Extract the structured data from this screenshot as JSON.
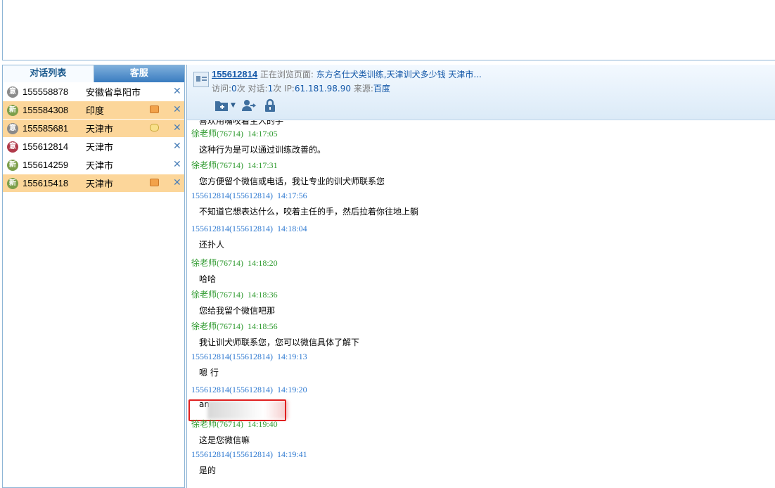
{
  "left_tabs": {
    "active": "对话列表",
    "inactive": "客服"
  },
  "conversations": [
    {
      "badge": "意",
      "id": "155558878",
      "location": "安徽省阜阳市"
    },
    {
      "badge": "新",
      "id": "155584308",
      "location": "印度"
    },
    {
      "badge": "意",
      "id": "155585681",
      "location": "天津市"
    },
    {
      "badge": "意",
      "id": "155612814",
      "location": "天津市"
    },
    {
      "badge": "新",
      "id": "155614259",
      "location": "天津市"
    },
    {
      "badge": "新",
      "id": "155615418",
      "location": "天津市"
    }
  ],
  "close_glyph": "✕",
  "header": {
    "visitor_id": "155612814",
    "browsing_label": "正在浏览页面:",
    "browsing_page": "东方名仕犬类训练,天津训犬多少钱 天津市...",
    "visits_label": "访问:",
    "visits_value": "0",
    "times_unit": "次",
    "dialog_label": " 对话:",
    "dialog_value": "1",
    "ip_label": " IP:",
    "ip_value": "61.181.98.90",
    "source_label": " 来源:",
    "source_value": "百度"
  },
  "chat": {
    "partial_text": "喜欢用嘴咬着主人的手",
    "messages": [
      {
        "sender": "徐老师(76714)",
        "time": "14:17:05",
        "text": "这种行为是可以通过训练改善的。",
        "role": "agent"
      },
      {
        "sender": "徐老师(76714)",
        "time": "14:17:31",
        "text": "您方便留个微信或电话，我让专业的训犬师联系您",
        "role": "agent"
      },
      {
        "sender": "155612814(155612814)",
        "time": "14:17:56",
        "text": "不知道它想表达什么，咬着主任的手，然后拉着你往地上躺",
        "role": "visitor"
      },
      {
        "sender": "155612814(155612814)",
        "time": "14:18:04",
        "text": "还扑人",
        "role": "visitor"
      },
      {
        "sender": "徐老师(76714)",
        "time": "14:18:20",
        "text": "哈哈",
        "role": "agent"
      },
      {
        "sender": "徐老师(76714)",
        "time": "14:18:36",
        "text": "您给我留个微信吧那",
        "role": "agent"
      },
      {
        "sender": "徐老师(76714)",
        "time": "14:18:56",
        "text": "我让训犬师联系您，您可以微信具体了解下",
        "role": "agent"
      },
      {
        "sender": "155612814(155612814)",
        "time": "14:19:13",
        "text": "嗯  行",
        "role": "visitor"
      },
      {
        "sender": "155612814(155612814)",
        "time": "14:19:20",
        "text": "an",
        "role": "visitor"
      },
      {
        "sender": "徐老师(76714)",
        "time": "14:19:40",
        "text": "这是您微信嘛",
        "role": "agent"
      },
      {
        "sender": "155612814(155612814)",
        "time": "14:19:41",
        "text": "是的",
        "role": "visitor"
      }
    ]
  }
}
